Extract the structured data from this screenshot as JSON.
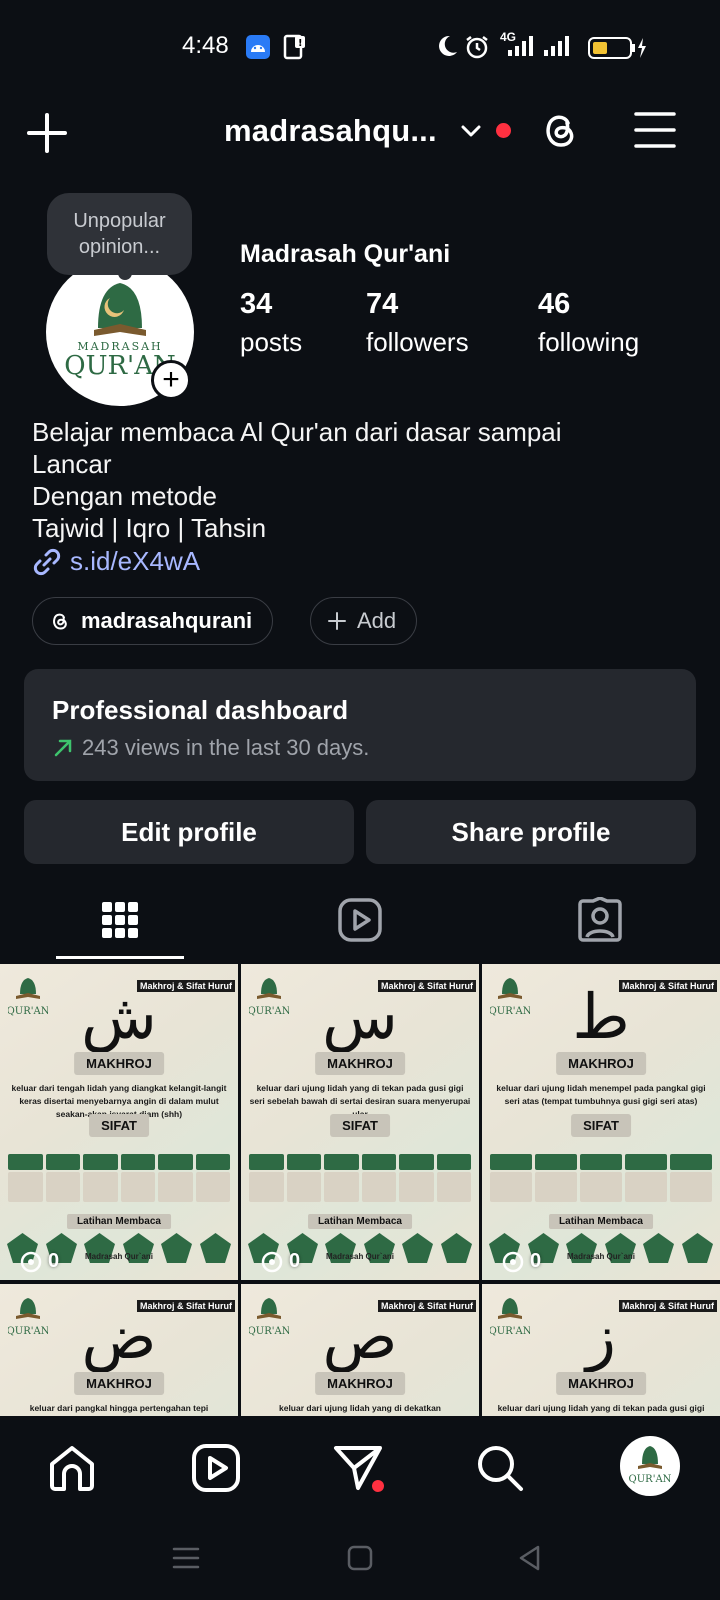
{
  "status_bar": {
    "time": "4:48",
    "network": "4G"
  },
  "header": {
    "username": "madrasahqu...",
    "has_notification_dot": true
  },
  "profile": {
    "note": "Unpopular opinion...",
    "display_name": "Madrasah Qur'ani",
    "stats": [
      {
        "num": "34",
        "label": "posts"
      },
      {
        "num": "74",
        "label": "followers"
      },
      {
        "num": "46",
        "label": "following"
      }
    ],
    "bio_lines": [
      "Belajar membaca Al Qur'an dari dasar sampai",
      "Lancar",
      "Dengan metode",
      "Tajwid | Iqro | Tahsin"
    ],
    "link": "s.id/eX4wA",
    "threads_chip": "madrasahqurani",
    "add_chip": "Add"
  },
  "dashboard": {
    "title": "Professional dashboard",
    "subtitle": "243 views in the last 30 days."
  },
  "buttons": {
    "edit": "Edit profile",
    "share": "Share profile"
  },
  "tabs": [
    "grid-icon",
    "reels-icon",
    "tagged-icon"
  ],
  "posts": [
    {
      "letter": "ش",
      "tag": "Makhroj & Sifat Huruf",
      "makhroj": "MAKHROJ",
      "desc": "keluar dari tengah lidah yang diangkat kelangit-langit keras disertai menyebarnya angin di dalam mulut seakan-akan isyarat diam (shh)",
      "sifat": "SIFAT",
      "latihan": "Latihan Membaca",
      "views": "0",
      "footer": "Madrasah Qur`ani"
    },
    {
      "letter": "س",
      "tag": "Makhroj & Sifat Huruf",
      "makhroj": "MAKHROJ",
      "desc": "keluar dari ujung lidah yang di tekan pada gusi gigi seri sebelah bawah di sertai desiran suara menyerupai ular",
      "sifat": "SIFAT",
      "latihan": "Latihan Membaca",
      "views": "0",
      "footer": "Madrasah Qur`ani"
    },
    {
      "letter": "ط",
      "tag": "Makhroj & Sifat Huruf",
      "makhroj": "MAKHROJ",
      "desc": "keluar dari ujung lidah menempel pada pangkal gigi seri atas (tempat tumbuhnya gusi gigi seri atas)",
      "sifat": "SIFAT",
      "latihan": "Latihan Membaca",
      "views": "0",
      "footer": "Madrasah Qur`ani"
    },
    {
      "letter": "ض",
      "tag": "Makhroj & Sifat Huruf",
      "makhroj": "MAKHROJ",
      "desc": "keluar dari pangkal hingga pertengahan tepi"
    },
    {
      "letter": "ص",
      "tag": "Makhroj & Sifat Huruf",
      "makhroj": "MAKHROJ",
      "desc": "keluar dari ujung lidah yang di dekatkan"
    },
    {
      "letter": "ز",
      "tag": "Makhroj & Sifat Huruf",
      "makhroj": "MAKHROJ",
      "desc": "keluar dari ujung lidah yang di tekan pada gusi gigi"
    }
  ],
  "logo_text": "QUR'AN",
  "colors": {
    "accent_link": "#a8b8ff",
    "notification": "#ff3040",
    "trend_green": "#3ec46d",
    "post_green": "#2e6a44"
  }
}
